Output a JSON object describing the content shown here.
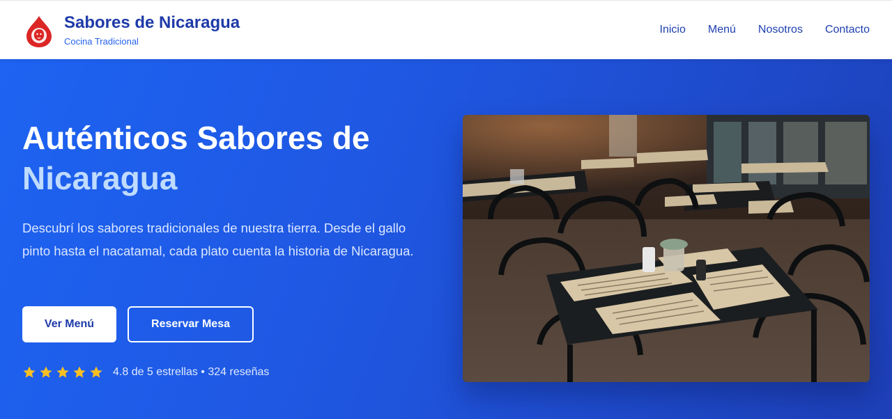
{
  "brand": {
    "title": "Sabores de Nicaragua",
    "subtitle": "Cocina Tradicional",
    "logo_icon": "lion-drop-icon"
  },
  "nav": {
    "items": [
      {
        "label": "Inicio"
      },
      {
        "label": "Menú"
      },
      {
        "label": "Nosotros"
      },
      {
        "label": "Contacto"
      }
    ]
  },
  "hero": {
    "title_line1": "Auténticos Sabores de",
    "title_line2": "Nicaragua",
    "description": "Descubrí los sabores tradicionales de nuestra tierra. Desde el gallo pinto hasta el nacatamal, cada plato cuenta la historia de Nicaragua.",
    "primary_button": "Ver Menú",
    "secondary_button": "Reservar Mesa",
    "rating": {
      "stars": 5,
      "text": "4.8 de 5 estrellas • 324 reseñas"
    },
    "image_icon": "restaurant-interior-photo"
  },
  "colors": {
    "brand_blue": "#1e3aa8",
    "accent_light_blue": "#bfdbfe",
    "star_yellow": "#fbbf24",
    "logo_red": "#dc2626"
  }
}
